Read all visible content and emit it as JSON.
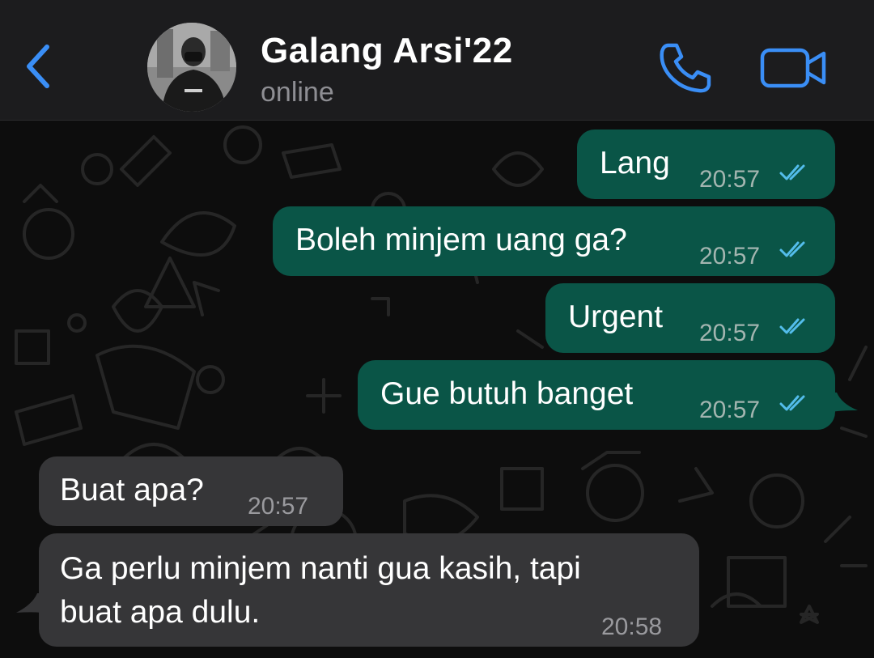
{
  "header": {
    "contact_name": "Galang Arsi'22",
    "status": "online",
    "back_icon": "chevron-left-icon",
    "call_icon": "phone-icon",
    "video_icon": "video-camera-icon",
    "accent_color": "#3a8ef6"
  },
  "messages": [
    {
      "direction": "outgoing",
      "text": "Lang",
      "time": "20:57",
      "read": true
    },
    {
      "direction": "outgoing",
      "text": "Boleh minjem uang ga?",
      "time": "20:57",
      "read": true
    },
    {
      "direction": "outgoing",
      "text": "Urgent",
      "time": "20:57",
      "read": true
    },
    {
      "direction": "outgoing",
      "text": "Gue butuh banget",
      "time": "20:57",
      "read": true
    },
    {
      "direction": "incoming",
      "text": "Buat apa?",
      "time": "20:57"
    },
    {
      "direction": "incoming",
      "text_line1": "Ga perlu minjem nanti gua kasih, tapi",
      "text_line2": "buat apa dulu.",
      "time": "20:58"
    }
  ],
  "colors": {
    "outgoing_bubble": "#0a5547",
    "incoming_bubble": "#363638",
    "read_ticks": "#53bdeb"
  }
}
